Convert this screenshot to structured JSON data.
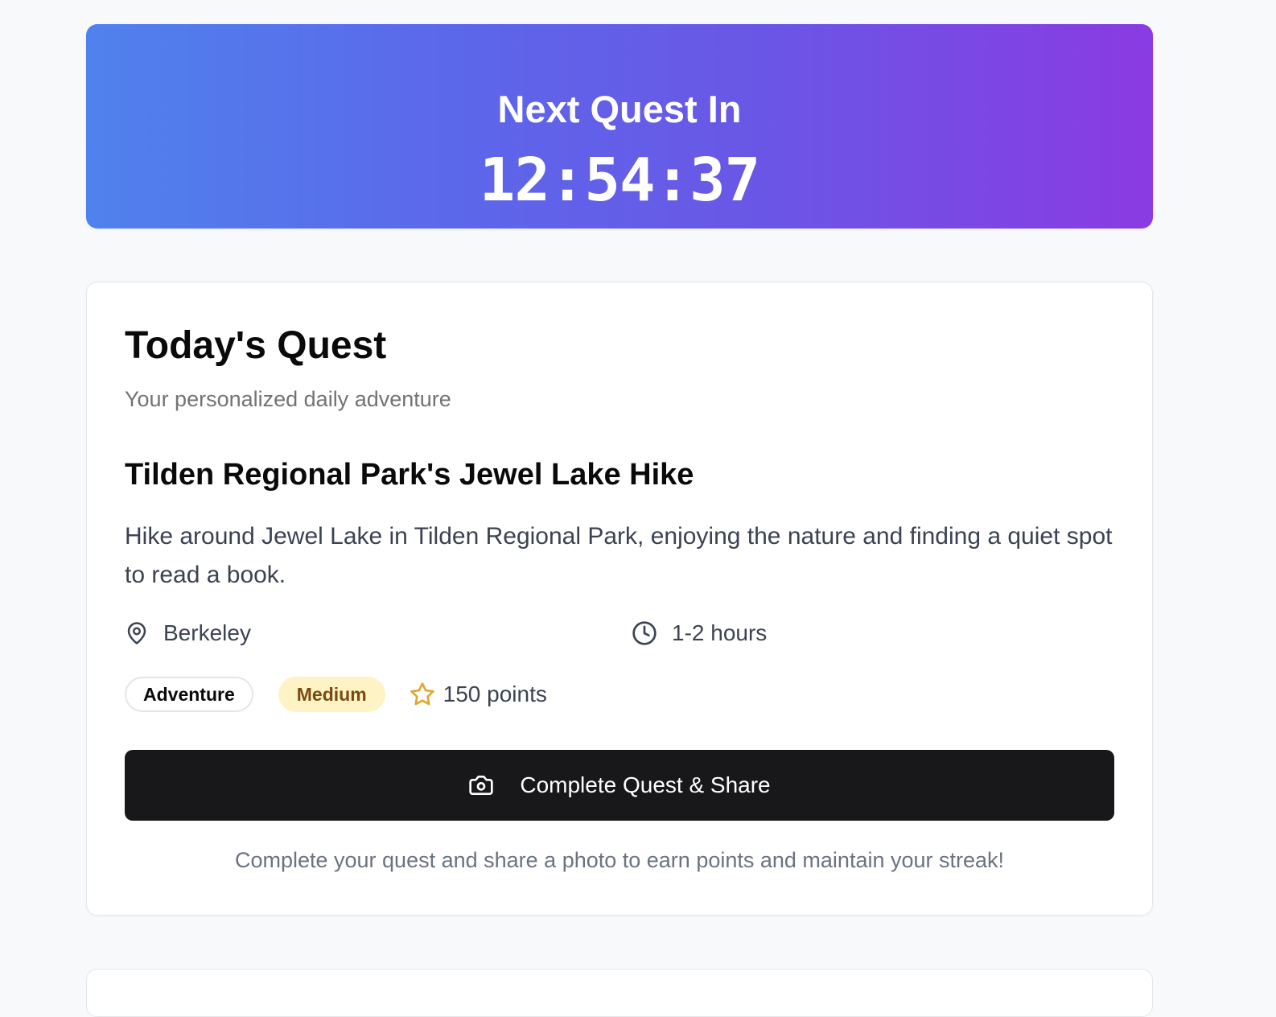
{
  "countdown": {
    "title": "Next Quest In",
    "time": "12:54:37"
  },
  "quest_card": {
    "title": "Today's Quest",
    "subtitle": "Your personalized daily adventure",
    "quest": {
      "name": "Tilden Regional Park's Jewel Lake Hike",
      "description": "Hike around Jewel Lake in Tilden Regional Park, enjoying the nature and finding a quiet spot to read a book.",
      "location": "Berkeley",
      "duration": "1-2 hours",
      "category": "Adventure",
      "difficulty": "Medium",
      "points": "150 points"
    },
    "cta_label": "Complete Quest & Share",
    "footnote": "Complete your quest and share a photo to earn points and maintain your streak!"
  },
  "icons": {
    "location": "map-pin-icon",
    "duration": "clock-icon",
    "points": "star-icon",
    "cta": "camera-icon"
  },
  "colors": {
    "gradient_start": "#4f82ec",
    "gradient_end": "#8a3be2",
    "difficulty_bg": "#fdf3c4",
    "difficulty_text": "#7a4a12",
    "star": "#e0a82e",
    "cta_bg": "#18181a"
  }
}
